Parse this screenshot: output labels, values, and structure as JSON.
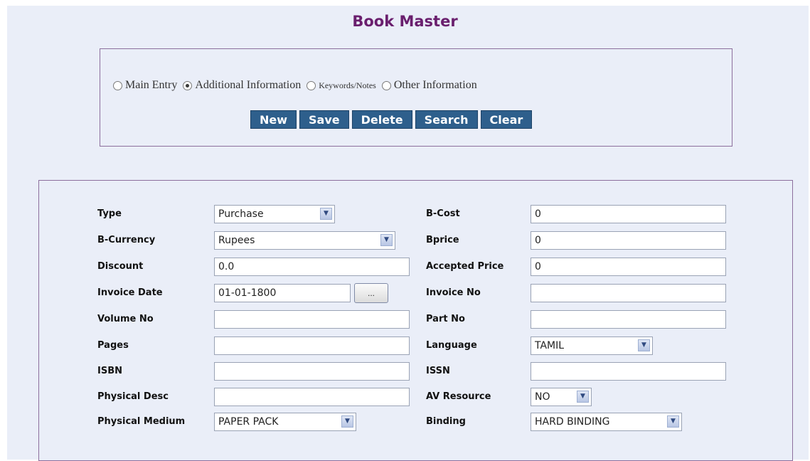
{
  "page": {
    "title": "Book Master"
  },
  "entry_mode": {
    "options": [
      {
        "label": "Main Entry",
        "checked": false
      },
      {
        "label": "Additional Information",
        "checked": true
      },
      {
        "label": "Keywords/Notes",
        "checked": false
      },
      {
        "label": "Other Information",
        "checked": false
      }
    ]
  },
  "toolbar": {
    "new_label": "New",
    "save_label": "Save",
    "delete_label": "Delete",
    "search_label": "Search",
    "clear_label": "Clear"
  },
  "form": {
    "type": {
      "label": "Type",
      "value": "Purchase"
    },
    "b_currency": {
      "label": "B-Currency",
      "value": "Rupees"
    },
    "discount": {
      "label": "Discount",
      "value": "0.0"
    },
    "invoice_date": {
      "label": "Invoice Date",
      "value": "01-01-1800",
      "picker_label": "..."
    },
    "volume_no": {
      "label": "Volume No",
      "value": ""
    },
    "pages": {
      "label": "Pages",
      "value": ""
    },
    "isbn": {
      "label": "ISBN",
      "value": ""
    },
    "physical_desc": {
      "label": "Physical Desc",
      "value": ""
    },
    "physical_medium": {
      "label": "Physical Medium",
      "value": "PAPER PACK"
    },
    "b_cost": {
      "label": "B-Cost",
      "value": "0"
    },
    "bprice": {
      "label": "Bprice",
      "value": "0"
    },
    "accepted_price": {
      "label": "Accepted Price",
      "value": "0"
    },
    "invoice_no": {
      "label": "Invoice No",
      "value": ""
    },
    "part_no": {
      "label": "Part No",
      "value": ""
    },
    "language": {
      "label": "Language",
      "value": "TAMIL"
    },
    "issn": {
      "label": "ISSN",
      "value": ""
    },
    "av_resource": {
      "label": "AV Resource",
      "value": "NO"
    },
    "binding": {
      "label": "Binding",
      "value": "HARD BINDING"
    }
  },
  "icons": {
    "dropdown": "chevron-down-icon"
  },
  "colors": {
    "title": "#6a1f6e",
    "button_bg": "#2e5f8c",
    "panel_bg": "#eaeef8",
    "border": "#8c6f9d"
  }
}
